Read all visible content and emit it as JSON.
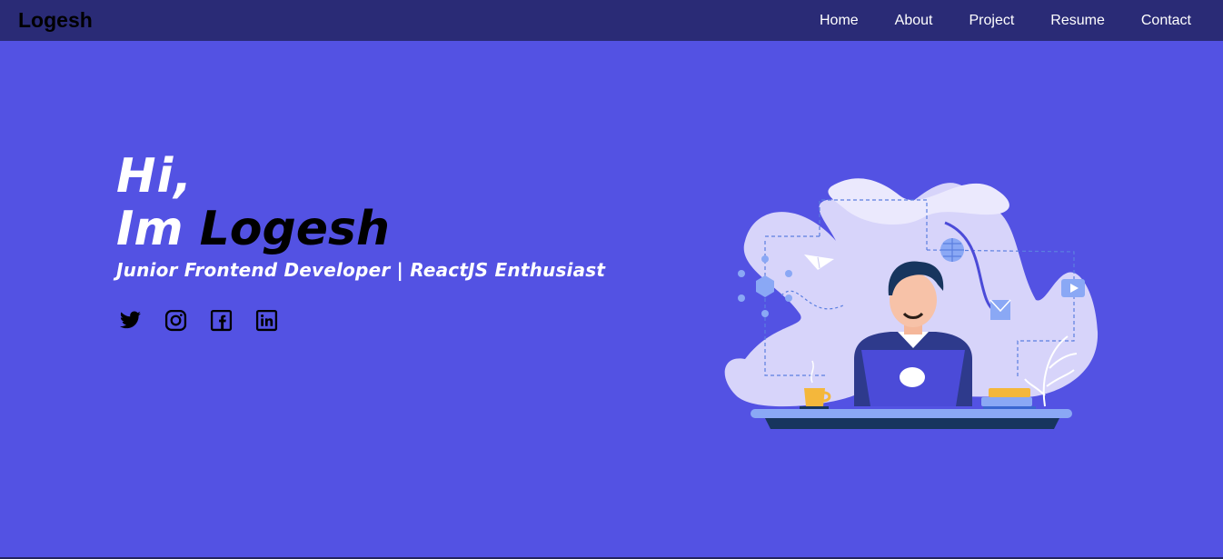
{
  "navbar": {
    "brand": "Logesh",
    "links": [
      "Home",
      "About",
      "Project",
      "Resume",
      "Contact"
    ]
  },
  "hero": {
    "greeting": "Hi,",
    "intro_prefix": "Im",
    "name": "Logesh",
    "tagline": "Junior Frontend Developer | ReactJS Enthusiast"
  },
  "socials": [
    "twitter-icon",
    "instagram-icon",
    "facebook-icon",
    "linkedin-icon"
  ],
  "colors": {
    "background": "#5352e3",
    "navbar": "#2a2b76",
    "accent": "#ffffff"
  }
}
